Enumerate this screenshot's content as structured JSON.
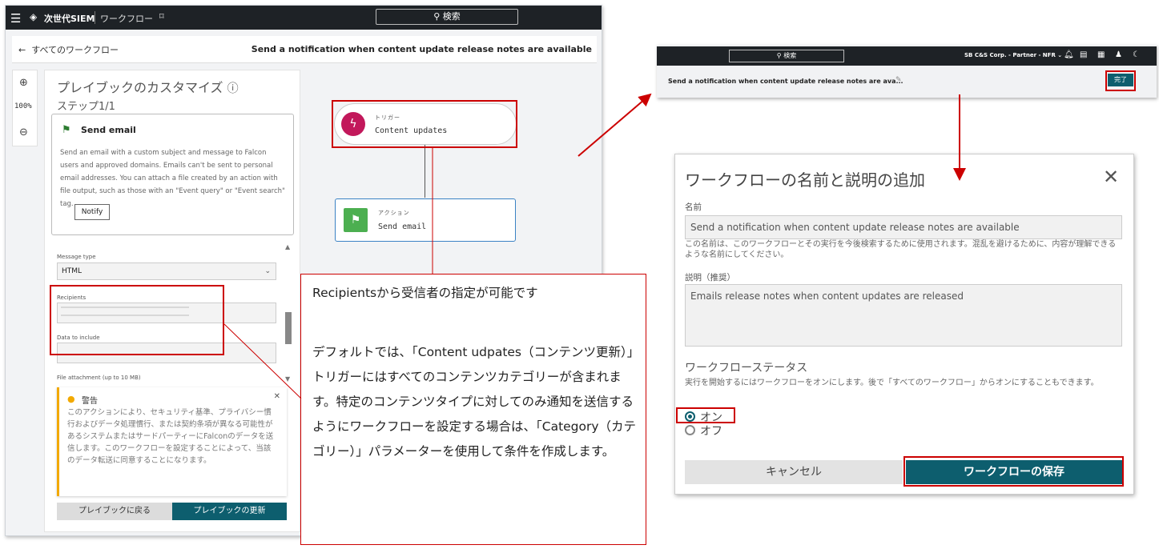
{
  "app": {
    "menu_icon": "hamburger-menu-icon",
    "brand": "次世代SIEM",
    "section": "ワークフロー",
    "search_label": "検索"
  },
  "subbar": {
    "back_label": "すべてのワークフロー",
    "workflow_title": "Send a notification when content update release notes are available"
  },
  "zoom": {
    "zoom_in_icon": "zoom-in-icon",
    "level": "100%",
    "zoom_out_icon": "zoom-out-icon"
  },
  "panel": {
    "title": "プレイブックのカスタマイズ",
    "step": "ステップ1/1",
    "action_card": {
      "title": "Send email",
      "description": "Send an email with a custom subject and message to Falcon users and approved domains. Emails can't be sent to personal email addresses. You can attach a file created by an action with file output, such as those with an \"Event query\" or \"Event search\" tag.",
      "button": "Notify"
    },
    "fields": {
      "message_type_label": "Message type",
      "message_type_value": "HTML",
      "recipients_label": "Recipients",
      "data_label": "Data to include",
      "attachment_label": "File attachment (up to 10 MB)"
    },
    "warning": {
      "title": "警告",
      "text": "このアクションにより、セキュリティ基準、プライバシー慣行およびデータ処理慣行、または契約条項が異なる可能性があるシステムまたはサードパーティーにFalconのデータを送信します。このワークフローを設定することによって、当該のデータ転送に同意することになります。"
    },
    "back_button": "プレイブックに戻る",
    "update_button": "プレイブックの更新"
  },
  "canvas": {
    "trigger": {
      "kind": "トリガー",
      "name": "Content updates"
    },
    "action": {
      "kind": "アクション",
      "name": "Send email"
    }
  },
  "callout": {
    "line1": "Recipientsから受信者の指定が可能です",
    "body": "デフォルトでは、「Content udpates（コンテンツ更新）」トリガーにはすべてのコンテンツカテゴリーが含まれます。特定のコンテンツタイプに対してのみ通知を送信するようにワークフローを設定する場合は、「Category（カテゴリー）」パラメーターを使用して条件を作成します。"
  },
  "right_header": {
    "search_label": "検索",
    "org": "SB C&S Corp. - Partner - NFR",
    "workflow_title": "Send a notification when content update release notes are ava...",
    "done_button": "完了"
  },
  "dialog": {
    "title": "ワークフローの名前と説明の追加",
    "name_label": "名前",
    "name_value": "Send a notification when content update release notes are available",
    "name_hint": "この名前は、このワークフローとその実行を今後検索するために使用されます。混乱を避けるために、内容が理解できるような名前にしてください。",
    "desc_label": "説明（推奨）",
    "desc_value": "Emails release notes when content updates are released",
    "status_title": "ワークフローステータス",
    "status_hint": "実行を開始するにはワークフローをオンにします。後で「すべてのワークフロー」からオンにすることもできます。",
    "on_label": "オン",
    "off_label": "オフ",
    "status_on": true,
    "cancel_button": "キャンセル",
    "save_button": "ワークフローの保存"
  },
  "colors": {
    "accent": "#0d5e6e",
    "annotation": "#cc0000",
    "trigger": "#c2185b",
    "action": "#4caf50",
    "warning": "#f2a900"
  }
}
